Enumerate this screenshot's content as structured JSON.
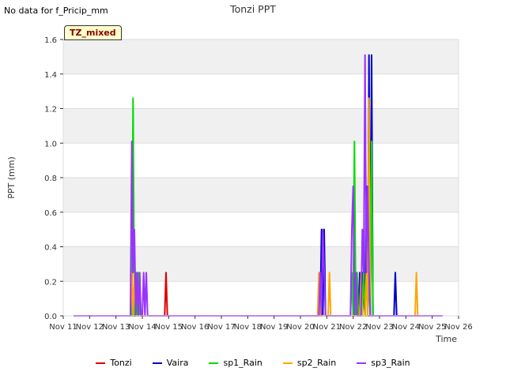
{
  "note": "No data for f_Pricip_mm",
  "badge": "TZ_mixed",
  "chart_data": {
    "type": "line",
    "title": "Tonzi PPT",
    "xlabel": "Time",
    "ylabel": "PPT (mm)",
    "xlim": [
      0,
      15
    ],
    "ylim": [
      0,
      1.6
    ],
    "x_ticks": [
      0,
      1,
      2,
      3,
      4,
      5,
      6,
      7,
      8,
      9,
      10,
      11,
      12,
      13,
      14,
      15
    ],
    "x_tick_labels": [
      "Nov 11",
      "Nov 12",
      "Nov 13",
      "Nov 14",
      "Nov 15",
      "Nov 16",
      "Nov 17",
      "Nov 18",
      "Nov 19",
      "Nov 20",
      "Nov 21",
      "Nov 22",
      "Nov 23",
      "Nov 24",
      "Nov 25",
      "Nov 26"
    ],
    "y_ticks": [
      0.0,
      0.2,
      0.4,
      0.6,
      0.8,
      1.0,
      1.2,
      1.4,
      1.6
    ],
    "y_tick_labels": [
      "0.0",
      "0.2",
      "0.4",
      "0.6",
      "0.8",
      "1.0",
      "1.2",
      "1.4",
      "1.6"
    ],
    "legend_position": "bottom",
    "grid": true,
    "series": [
      {
        "name": "Tonzi",
        "color": "#dd0000",
        "x": [
          0.4,
          3.85,
          3.9,
          3.95,
          14.4
        ],
        "y": [
          0,
          0,
          0.25,
          0,
          0
        ]
      },
      {
        "name": "Vaira",
        "color": "#0000cc",
        "x": [
          0.4,
          9.75,
          9.8,
          9.85,
          9.9,
          9.95,
          10.0,
          11.2,
          11.25,
          11.3,
          11.35,
          11.45,
          11.5,
          11.55,
          11.6,
          11.65,
          11.7,
          11.75,
          11.8,
          12.55,
          12.6,
          12.65,
          14.4
        ],
        "y": [
          0,
          0,
          0.5,
          0,
          0.5,
          0,
          0,
          0,
          0.25,
          0,
          0.25,
          0,
          0.75,
          0,
          1.51,
          0,
          1.51,
          0,
          0,
          0,
          0.25,
          0,
          0
        ]
      },
      {
        "name": "sp1_Rain",
        "color": "#00dd00",
        "x": [
          0.4,
          2.6,
          2.65,
          2.7,
          2.75,
          2.8,
          2.85,
          2.9,
          10.9,
          10.95,
          11.0,
          11.05,
          11.1,
          11.15,
          11.2,
          11.25,
          11.3,
          11.35,
          11.4,
          11.45,
          11.5,
          11.55,
          11.6,
          11.65,
          11.7,
          11.75,
          11.8,
          14.4
        ],
        "y": [
          0,
          0,
          1.26,
          0,
          0.25,
          0,
          0.25,
          0,
          0,
          0.25,
          0,
          1.01,
          0,
          0.25,
          0,
          0,
          0.25,
          0,
          0.25,
          0,
          0,
          0,
          0.25,
          0,
          1.01,
          0,
          0,
          0
        ]
      },
      {
        "name": "sp2_Rain",
        "color": "#ffa500",
        "x": [
          0.4,
          2.55,
          2.6,
          2.65,
          2.7,
          2.75,
          2.8,
          9.65,
          9.7,
          9.75,
          10.05,
          10.1,
          10.15,
          11.25,
          11.3,
          11.35,
          11.4,
          11.45,
          11.5,
          11.55,
          11.6,
          11.65,
          13.35,
          13.4,
          13.45,
          14.4
        ],
        "y": [
          0,
          0,
          0.25,
          0,
          0.25,
          0,
          0,
          0,
          0.25,
          0,
          0,
          0.25,
          0,
          0,
          0.25,
          0,
          0,
          0,
          0.25,
          0,
          1.26,
          0,
          0,
          0.25,
          0,
          0
        ]
      },
      {
        "name": "sp3_Rain",
        "color": "#9933ff",
        "x": [
          0.4,
          2.55,
          2.6,
          2.65,
          2.7,
          2.75,
          2.8,
          2.85,
          2.9,
          2.95,
          3.0,
          3.05,
          3.1,
          3.15,
          3.2,
          9.7,
          9.75,
          9.8,
          9.85,
          9.9,
          9.95,
          10.0,
          10.9,
          10.95,
          11.0,
          11.05,
          11.1,
          11.15,
          11.2,
          11.25,
          11.3,
          11.35,
          11.4,
          11.45,
          11.5,
          11.55,
          11.6,
          11.65,
          11.7,
          11.75,
          11.8,
          14.4
        ],
        "y": [
          0,
          0,
          1.01,
          0.25,
          0.5,
          0,
          0.25,
          0,
          0.25,
          0,
          0,
          0.25,
          0,
          0.25,
          0,
          0,
          0.25,
          0,
          0.5,
          0.25,
          0,
          0,
          0,
          0.5,
          0.75,
          0,
          0.25,
          0,
          0,
          0,
          0,
          0.5,
          0.25,
          1.51,
          0.25,
          0.75,
          0.25,
          0,
          0,
          0,
          0,
          0
        ]
      }
    ]
  }
}
